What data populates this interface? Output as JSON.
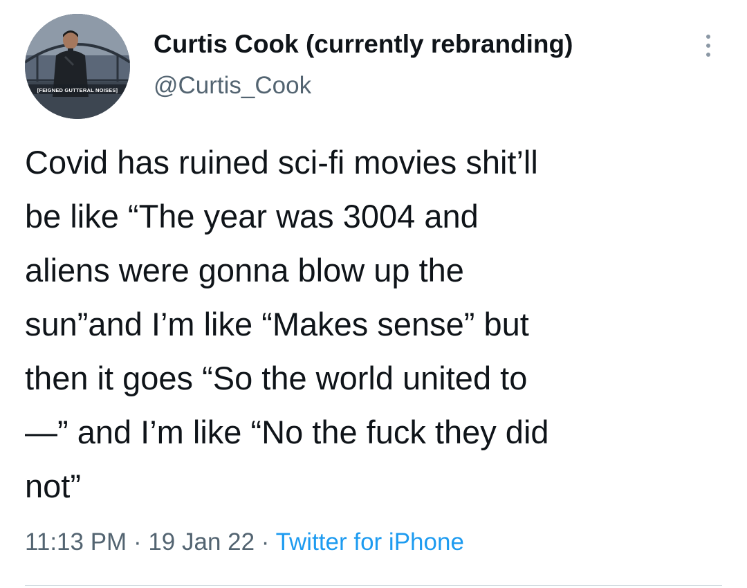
{
  "author": {
    "display_name": "Curtis Cook (currently rebranding)",
    "handle": "@Curtis_Cook",
    "avatar_caption": "[FEIGNED GUTTERAL NOISES]"
  },
  "tweet": {
    "text": "Covid has ruined sci-fi movies shit’ll\nbe like “The year was 3004 and\naliens were gonna blow up the\nsun”and I’m like “Makes sense” but\nthen it goes “So the world united to\n—” and I’m like “No the fuck they did\nnot”"
  },
  "meta": {
    "time": "11:13 PM",
    "separator": " · ",
    "date": "19 Jan 22",
    "source": "Twitter for iPhone"
  },
  "icons": {
    "more": "more-vertical-icon"
  },
  "colors": {
    "text_primary": "#0f1419",
    "text_secondary": "#536471",
    "link": "#1d9bf0"
  }
}
